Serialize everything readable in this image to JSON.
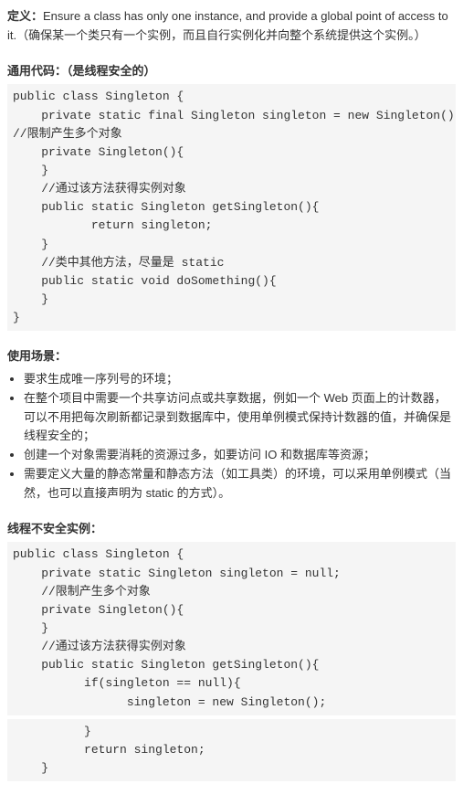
{
  "definition": {
    "label": "定义：",
    "text": "Ensure a class has only one instance, and provide a global point of access to it.（确保某一个类只有一个实例，而且自行实例化并向整个系统提供这个实例。）"
  },
  "section1": {
    "heading": "通用代码：（是线程安全的）",
    "code": "public class Singleton {\n    private static final Singleton singleton = new Singleton();\n//限制产生多个对象\n    private Singleton(){\n    }\n    //通过该方法获得实例对象\n    public static Singleton getSingleton(){\n           return singleton;\n    }\n    //类中其他方法，尽量是 static\n    public static void doSomething(){\n    }\n}"
  },
  "section2": {
    "heading": "使用场景：",
    "items": [
      "要求生成唯一序列号的环境；",
      "在整个项目中需要一个共享访问点或共享数据，例如一个 Web 页面上的计数器，可以不用把每次刷新都记录到数据库中，使用单例模式保持计数器的值，并确保是线程安全的；",
      "创建一个对象需要消耗的资源过多，如要访问 IO 和数据库等资源；",
      "需要定义大量的静态常量和静态方法（如工具类）的环境，可以采用单例模式（当然，也可以直接声明为 static 的方式）。"
    ]
  },
  "section3": {
    "heading": "线程不安全实例：",
    "code1": "public class Singleton {\n    private static Singleton singleton = null;\n    //限制产生多个对象\n    private Singleton(){\n    }\n    //通过该方法获得实例对象\n    public static Singleton getSingleton(){\n          if(singleton == null){\n                singleton = new Singleton();",
    "code2": "          }\n          return singleton;\n    }"
  }
}
